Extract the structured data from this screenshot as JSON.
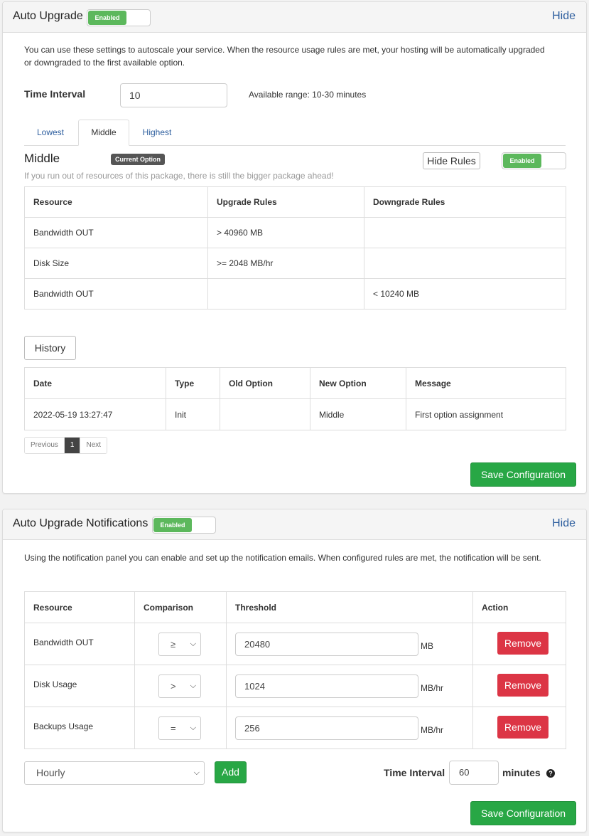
{
  "upgrade_panel": {
    "title": "Auto Upgrade",
    "toggle_label": "Enabled",
    "hide_label": "Hide",
    "description": "You can use these settings to autoscale your service. When the resource usage rules are met, your hosting will be automatically upgraded or downgraded to the first available option.",
    "time_interval_label": "Time Interval",
    "time_interval_value": "10",
    "available_range": "Available range: 10-30 minutes",
    "tabs": [
      "Lowest",
      "Middle",
      "Highest"
    ],
    "active_tab": "Middle",
    "option_title": "Middle",
    "current_badge": "Current Option",
    "hide_rules_label": "Hide Rules",
    "option_toggle_label": "Enabled",
    "option_note": "If you run out of resources of this package, there is still the bigger package ahead!",
    "rules_headers": [
      "Resource",
      "Upgrade Rules",
      "Downgrade Rules"
    ],
    "rules_rows": [
      [
        "Bandwidth OUT",
        "> 40960 MB",
        ""
      ],
      [
        "Disk Size",
        ">= 2048 MB/hr",
        ""
      ],
      [
        "Bandwidth OUT",
        "",
        "<  10240 MB"
      ]
    ],
    "history_label": "History",
    "history_headers": [
      "Date",
      "Type",
      "Old Option",
      "New Option",
      "Message"
    ],
    "history_rows": [
      [
        "2022-05-19 13:27:47",
        "Init",
        "",
        "Middle",
        "First option assignment"
      ]
    ],
    "pager": {
      "prev": "Previous",
      "page": "1",
      "next": "Next"
    },
    "save_label": "Save Configuration"
  },
  "notify_panel": {
    "title": "Auto Upgrade Notifications",
    "toggle_label": "Enabled",
    "hide_label": "Hide",
    "description": "Using the notification panel you can enable and set up the notification emails. When configured rules are met, the notification will be sent.",
    "headers": [
      "Resource",
      "Comparison",
      "Threshold",
      "Action"
    ],
    "rows": [
      {
        "resource": "Bandwidth OUT",
        "comparison": "≥",
        "threshold": "20480",
        "unit": "MB",
        "action": "Remove"
      },
      {
        "resource": "Disk Usage",
        "comparison": ">",
        "threshold": "1024",
        "unit": "MB/hr",
        "action": "Remove"
      },
      {
        "resource": "Backups Usage",
        "comparison": "=",
        "threshold": "256",
        "unit": "MB/hr",
        "action": "Remove"
      }
    ],
    "frequency": "Hourly",
    "add_label": "Add",
    "time_interval_label": "Time Interval",
    "time_interval_value": "60",
    "minutes_label": "minutes",
    "help_icon": "?",
    "save_label": "Save Configuration"
  },
  "colors": {
    "accent_green": "#28a745",
    "danger_red": "#dc3545",
    "link_blue": "#2d5e9e",
    "toggle_green": "#5cb85c"
  }
}
